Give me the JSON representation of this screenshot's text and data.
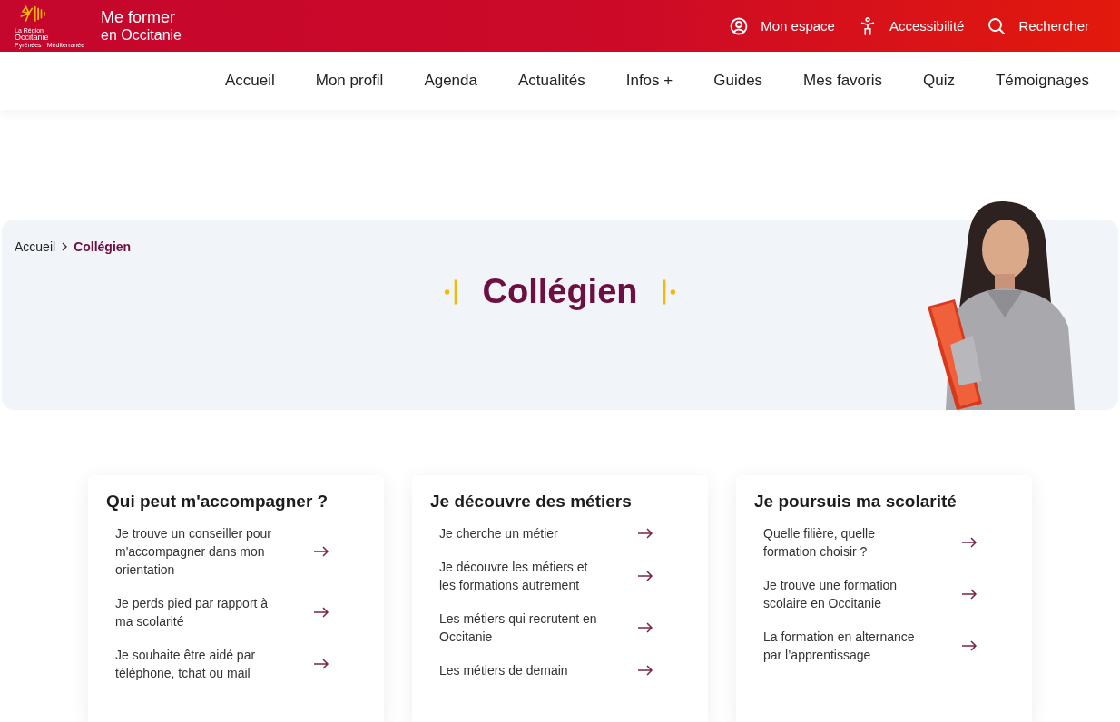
{
  "logo": {
    "region_lines": [
      "La Région",
      "Occitanie",
      "Pyrénées · Méditerranée"
    ],
    "title_lines": [
      "Me former",
      "en Occitanie"
    ]
  },
  "top_links": [
    {
      "kind": "account",
      "label": "Mon espace"
    },
    {
      "kind": "accessibility",
      "label": "Accessibilité"
    },
    {
      "kind": "search",
      "label": "Rechercher"
    }
  ],
  "nav": [
    {
      "label": "Accueil"
    },
    {
      "label": "Mon profil"
    },
    {
      "label": "Agenda"
    },
    {
      "label": "Actualités"
    },
    {
      "label": "Infos +"
    },
    {
      "label": "Guides"
    },
    {
      "label": "Mes favoris"
    },
    {
      "label": "Quiz"
    },
    {
      "label": "Témoignages"
    }
  ],
  "breadcrumb": [
    {
      "label": "Accueil",
      "selected": false
    },
    {
      "label": "Collégien",
      "selected": true
    }
  ],
  "hero": {
    "title": "Collégien",
    "kind": "picture"
  },
  "cards": [
    {
      "title": "Qui peut m'accompagner ?",
      "links": [
        "Je trouve un conseiller pour m'accompagner dans mon orientation",
        "Je perds pied par rapport à ma scolarité",
        "Je souhaite être aidé par téléphone, tchat ou mail"
      ]
    },
    {
      "title": "Je découvre des métiers",
      "links": [
        "Je cherche un métier",
        "Je découvre les métiers et les formations autrement",
        "Les métiers qui recrutent en Occitanie",
        "Les métiers de demain"
      ]
    },
    {
      "title": "Je poursuis ma scolarité",
      "links": [
        "Quelle filière, quelle formation choisir ?",
        "Je trouve une formation scolaire en Occitanie",
        "La formation en alternance par l’apprentissage"
      ]
    }
  ]
}
